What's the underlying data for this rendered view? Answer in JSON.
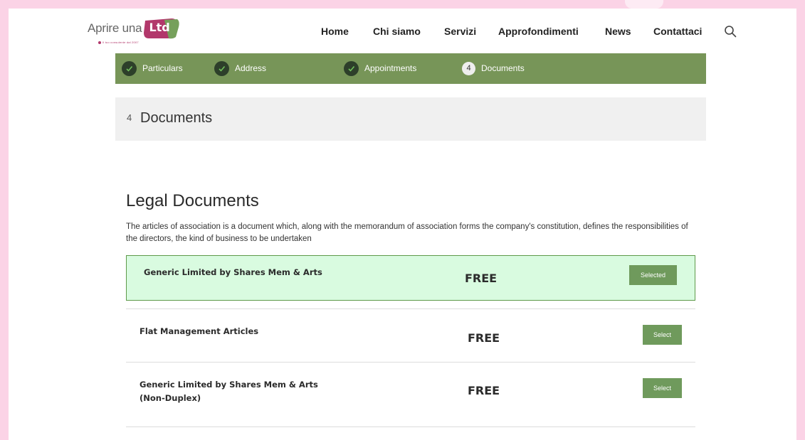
{
  "header": {
    "logo_text": "Aprire una",
    "logo_badge": "Ltd",
    "logo_tagline": "Il tuo consulente dal 2007",
    "nav": [
      "Home",
      "Chi siamo",
      "Servizi",
      "Approfondimenti",
      "News",
      "Contattaci"
    ],
    "search_icon": "search-icon"
  },
  "steps": [
    {
      "label": "Particulars",
      "status": "complete",
      "icon": "check-icon"
    },
    {
      "label": "Address",
      "status": "complete",
      "icon": "check-icon"
    },
    {
      "label": "Appointments",
      "status": "complete",
      "icon": "check-icon"
    },
    {
      "label": "Documents",
      "status": "current",
      "number": "4"
    }
  ],
  "section": {
    "number": "4",
    "title": "Documents"
  },
  "legal": {
    "title": "Legal Documents",
    "description": "The articles of association is a document which, along with the memorandum of association forms the company's constitution, defines the responsibilities of the directors, the kind of business to be undertaken"
  },
  "documents": [
    {
      "name": "Generic Limited by Shares Mem & Arts",
      "price": "FREE",
      "button": "Selected",
      "selected": true
    },
    {
      "name": "Flat Management Articles",
      "price": "FREE",
      "button": "Select",
      "selected": false
    },
    {
      "name_line1": "Generic Limited by Shares Mem & Arts",
      "name_line2": "(Non-Duplex)",
      "price": "FREE",
      "button": "Select",
      "selected": false
    }
  ],
  "colors": {
    "page_border": "#fbd3e6",
    "steps_bar": "#779558",
    "selected_bg": "#d9fbe0",
    "selected_border": "#5e9a4a",
    "button": "#6f9a5c",
    "logo_magenta": "#b2386b",
    "logo_green": "#76a05b"
  }
}
